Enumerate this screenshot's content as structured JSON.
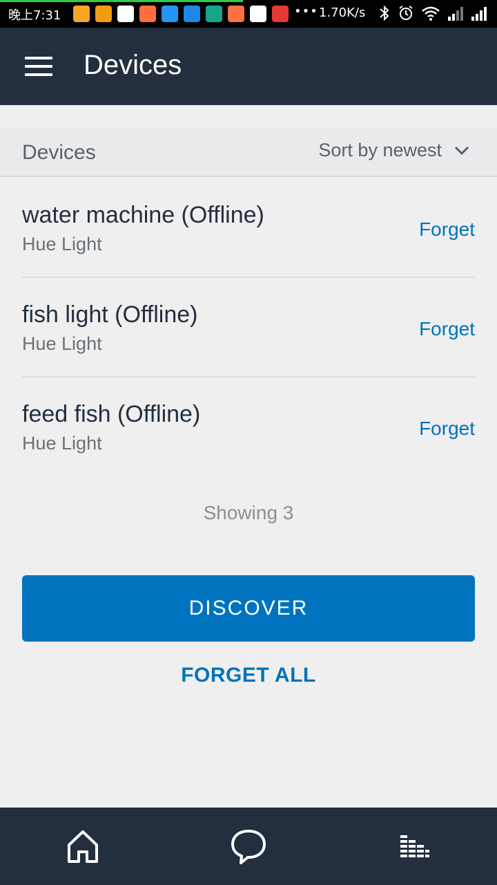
{
  "status_bar": {
    "time": "晚上7:31",
    "dots": "•••",
    "speed": "1.70K/s",
    "notification_colors": [
      "#f5a623",
      "#f39c12",
      "#ffffff",
      "#ff6f3c",
      "#2196f3",
      "#1e88e5",
      "#17a589",
      "#ff7043",
      "#ffffff",
      "#e53935"
    ]
  },
  "app_bar": {
    "title": "Devices",
    "menu_icon": "hamburger-menu-icon"
  },
  "list_header": {
    "label": "Devices",
    "sort_label": "Sort by newest",
    "sort_icon": "chevron-down-icon"
  },
  "devices": [
    {
      "name": "water machine (Offline)",
      "type": "Hue Light",
      "action": "Forget"
    },
    {
      "name": "fish light (Offline)",
      "type": "Hue Light",
      "action": "Forget"
    },
    {
      "name": "feed fish (Offline)",
      "type": "Hue Light",
      "action": "Forget"
    }
  ],
  "showing_text": "Showing 3",
  "discover_label": "DISCOVER",
  "forget_all_label": "FORGET ALL",
  "bottom_nav": {
    "items": [
      "home-icon",
      "chat-icon",
      "equalizer-icon"
    ]
  },
  "colors": {
    "app_bar": "#232f3e",
    "accent": "#0073bb",
    "background": "#efefef"
  }
}
